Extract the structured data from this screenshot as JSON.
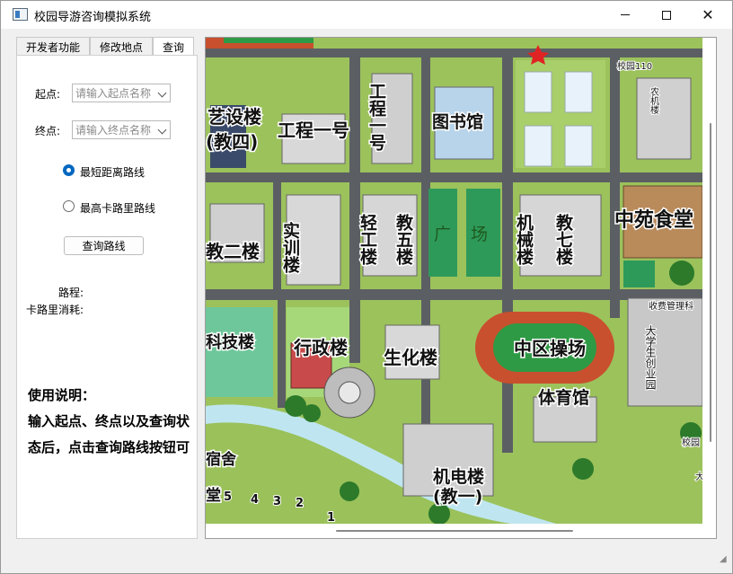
{
  "window": {
    "title": "校园导游咨询模拟系统"
  },
  "tabs": [
    {
      "label": "开发者功能"
    },
    {
      "label": "修改地点"
    },
    {
      "label": "查询"
    }
  ],
  "query": {
    "start_label": "起点:",
    "start_placeholder": "请输入起点名称",
    "end_label": "终点:",
    "end_placeholder": "请输入终点名称",
    "option_shortest": "最短距离路线",
    "option_calories": "最高卡路里路线",
    "selected_option": "最短距离路线",
    "search_button": "查询路线",
    "distance_label": "路程:",
    "calorie_label": "卡路里消耗:"
  },
  "instructions": {
    "heading": "使用说明：",
    "text": "输入起点、终点以及查询状态后，点击查询路线按钮可"
  },
  "map": {
    "labels": {
      "arts": "艺设楼",
      "arts_sub": "(教四)",
      "eng1": "工程一号",
      "eng_vertical": "工程一号",
      "library": "图书馆",
      "campus110": "校园110",
      "agri": "农机楼",
      "teach2": "教二楼",
      "training": "实训楼",
      "light": "轻工楼",
      "teach5": "教五楼",
      "square": "广场",
      "mech": "机械楼",
      "teach7": "教七楼",
      "canteen": "中苑食堂",
      "tech": "科技楼",
      "admin": "行政楼",
      "bio": "生化楼",
      "field": "中区操场",
      "toll": "收费管理科",
      "venture": "大学生创业园",
      "gym": "体育馆",
      "elec": "机电楼",
      "elec_sub": "(教一)",
      "dorm": "宿舍",
      "hall": "堂",
      "campus_edge": "校园",
      "big": "大",
      "n5": "5",
      "n4": "4",
      "n3": "3",
      "n2": "2",
      "n1": "1"
    }
  }
}
